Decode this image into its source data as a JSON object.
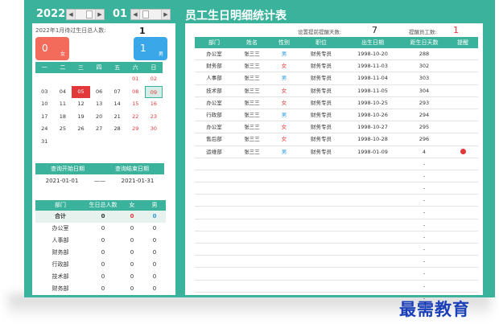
{
  "header": {
    "year": "2022",
    "month": "01",
    "title": "员工生日明细统计表"
  },
  "summary": {
    "label": "2022年1月待过生日总人数:",
    "total": "1",
    "female": {
      "count": "0",
      "label": "女"
    },
    "male": {
      "count": "1",
      "label": "男"
    }
  },
  "calendar": {
    "weekdays": [
      "一",
      "二",
      "三",
      "四",
      "五",
      "六",
      "日"
    ],
    "rows": [
      [
        "",
        "",
        "",
        "",
        "",
        "01",
        "02"
      ],
      [
        "03",
        "04",
        "05",
        "06",
        "07",
        "08",
        "09"
      ],
      [
        "10",
        "11",
        "12",
        "13",
        "14",
        "15",
        "16"
      ],
      [
        "17",
        "18",
        "19",
        "20",
        "21",
        "22",
        "23"
      ],
      [
        "24",
        "25",
        "26",
        "27",
        "28",
        "29",
        "30"
      ],
      [
        "31",
        "",
        "",
        "",
        "",
        "",
        ""
      ]
    ],
    "today": "05",
    "selected": "09"
  },
  "query": {
    "start_label": "查询开始日期",
    "end_label": "查询结束日期",
    "start": "2021-01-01",
    "separator": "——",
    "end": "2021-01-31"
  },
  "dept_stats": {
    "headers": [
      "部门",
      "生日总人数",
      "女",
      "男"
    ],
    "total": {
      "name": "合计",
      "count": "0",
      "female": "0",
      "male": "0"
    },
    "rows": [
      {
        "name": "办公室",
        "count": "0",
        "female": "0",
        "male": "0"
      },
      {
        "name": "人事部",
        "count": "0",
        "female": "0",
        "male": "0"
      },
      {
        "name": "财务部",
        "count": "0",
        "female": "0",
        "male": "0"
      },
      {
        "name": "行政部",
        "count": "0",
        "female": "0",
        "male": "0"
      },
      {
        "name": "技术部",
        "count": "0",
        "female": "0",
        "male": "0"
      },
      {
        "name": "财务部",
        "count": "0",
        "female": "0",
        "male": "0"
      }
    ]
  },
  "settings": {
    "remind_days_label": "设置提前提醒天数:",
    "remind_days": "7",
    "remind_count_label": "提醒员工数:",
    "remind_count": "1"
  },
  "employees": {
    "headers": [
      "部门",
      "姓名",
      "性别",
      "职位",
      "出生日期",
      "距生日天数",
      "提醒"
    ],
    "rows": [
      {
        "dept": "办公室",
        "name": "张三三",
        "gender": "男",
        "position": "财务专员",
        "birth": "1998-10-20",
        "days": "288",
        "remind": false
      },
      {
        "dept": "财务部",
        "name": "张三三",
        "gender": "女",
        "position": "财务专员",
        "birth": "1998-11-03",
        "days": "302",
        "remind": false
      },
      {
        "dept": "人事部",
        "name": "张三三",
        "gender": "男",
        "position": "财务专员",
        "birth": "1998-11-04",
        "days": "303",
        "remind": false
      },
      {
        "dept": "技术部",
        "name": "张三三",
        "gender": "女",
        "position": "财务专员",
        "birth": "1998-11-05",
        "days": "304",
        "remind": false
      },
      {
        "dept": "办公室",
        "name": "张三三",
        "gender": "女",
        "position": "财务专员",
        "birth": "1998-10-25",
        "days": "293",
        "remind": false
      },
      {
        "dept": "行政部",
        "name": "张三三",
        "gender": "男",
        "position": "财务专员",
        "birth": "1998-10-26",
        "days": "294",
        "remind": false
      },
      {
        "dept": "办公室",
        "name": "张三三",
        "gender": "女",
        "position": "财务专员",
        "birth": "1998-10-27",
        "days": "295",
        "remind": false
      },
      {
        "dept": "售后部",
        "name": "张三三",
        "gender": "女",
        "position": "财务专员",
        "birth": "1998-10-28",
        "days": "296",
        "remind": false
      },
      {
        "dept": "运维部",
        "name": "张三三",
        "gender": "男",
        "position": "财务专员",
        "birth": "1998-01-09",
        "days": "4",
        "remind": true
      }
    ],
    "empty_placeholder": "-",
    "empty_rows": 12
  },
  "watermark": "最需教育",
  "colors": {
    "teal": "#3bb39c",
    "red": "#e2383a",
    "blue": "#2a9ae0",
    "female_card": "#f26b5b",
    "male_card": "#3aa8e8",
    "watermark": "#1a3fb8"
  }
}
